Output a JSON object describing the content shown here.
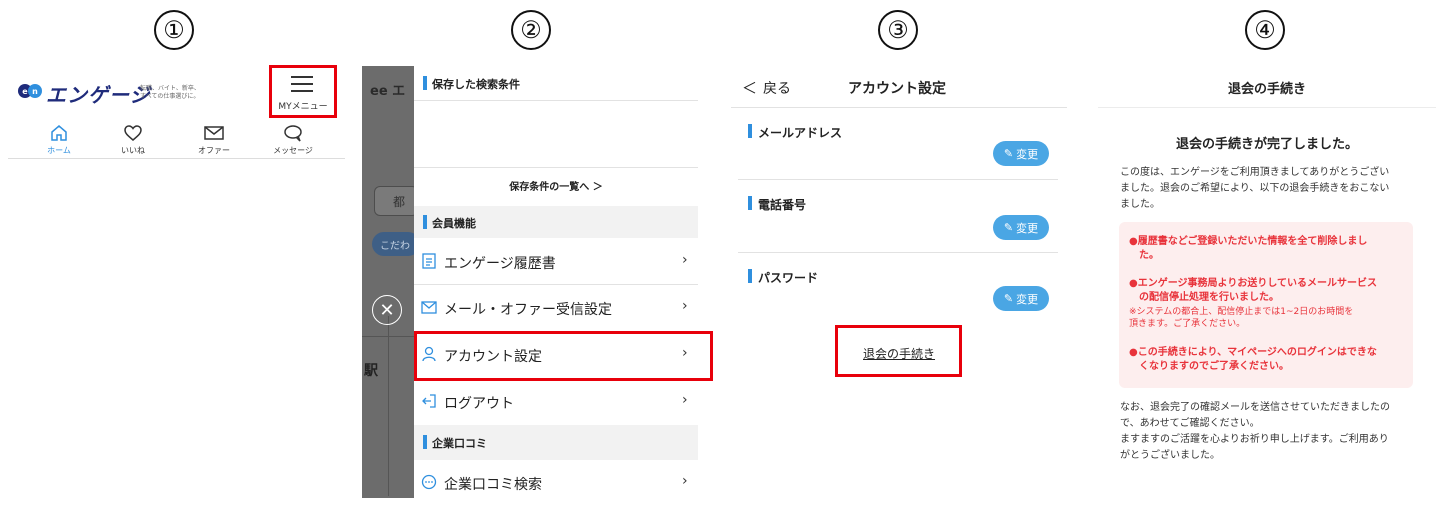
{
  "steps": [
    "①",
    "②",
    "③",
    "④"
  ],
  "colors": {
    "accent_blue": "#2f8fde",
    "button_blue": "#4aa6e4",
    "highlight_red": "#e8000b",
    "warning_red": "#e8333b",
    "warning_bg": "#fdeeee"
  },
  "panel1": {
    "logo_text": "エンゲージ",
    "logo_mark": "en",
    "tagline_line1": "転職、バイト、新卒、",
    "tagline_line2": "すべての仕事選びに。",
    "menu_label": "MYメニュー",
    "nav": [
      {
        "label": "ホーム",
        "icon": "home-icon"
      },
      {
        "label": "いいね",
        "icon": "heart-icon"
      },
      {
        "label": "オファー",
        "icon": "mail-icon"
      },
      {
        "label": "メッセージ",
        "icon": "chat-icon"
      }
    ]
  },
  "panel2": {
    "section_saved": "保存した検索条件",
    "saved_list_link": "保存条件の一覧へ ＞",
    "section_member": "会員機能",
    "member_items": [
      {
        "label": "エンゲージ履歴書",
        "icon": "document-icon"
      },
      {
        "label": "メール・オファー受信設定",
        "icon": "mail-icon"
      },
      {
        "label": "アカウント設定",
        "icon": "user-icon"
      },
      {
        "label": "ログアウト",
        "icon": "logout-icon"
      }
    ],
    "section_review": "企業口コミ",
    "review_items": [
      {
        "label": "企業口コミ検索",
        "icon": "chat-icon"
      }
    ],
    "bg_fragments": {
      "search_chip": "都",
      "tag_chip": "こだわ",
      "station": "駅"
    }
  },
  "panel3": {
    "back_label": "戻る",
    "title": "アカウント設定",
    "fields": [
      {
        "label": "メールアドレス"
      },
      {
        "label": "電話番号"
      },
      {
        "label": "パスワード"
      }
    ],
    "change_label": "変更",
    "withdraw_link": "退会の手続き"
  },
  "panel4": {
    "header_title": "退会の手続き",
    "heading": "退会の手続きが完了しました。",
    "intro_lines": [
      "この度は、エンゲージをご利用頂きましてありがとうござい",
      "ました。退会のご希望により、以下の退会手続きをおこない",
      "ました。"
    ],
    "warnings": [
      {
        "lines": [
          "●履歴書などご登録いただいた情報を全て削除しまし",
          "た。"
        ],
        "notes": []
      },
      {
        "lines": [
          "●エンゲージ事務局よりお送りしているメールサービス",
          "の配信停止処理を行いました。"
        ],
        "notes": [
          "※システムの都合上、配信停止までは1~2日のお時間を",
          "頂きます。ご了承ください。"
        ]
      },
      {
        "lines": [
          "●この手続きにより、マイページへのログインはできな",
          "くなりますのでご了承ください。"
        ],
        "notes": []
      }
    ],
    "outro_lines": [
      "なお、退会完了の確認メールを送信させていただきましたの",
      "で、あわせてご確認ください。",
      "ますますのご活躍を心よりお祈り申し上げます。ご利用あり",
      "がとうございました。"
    ]
  }
}
